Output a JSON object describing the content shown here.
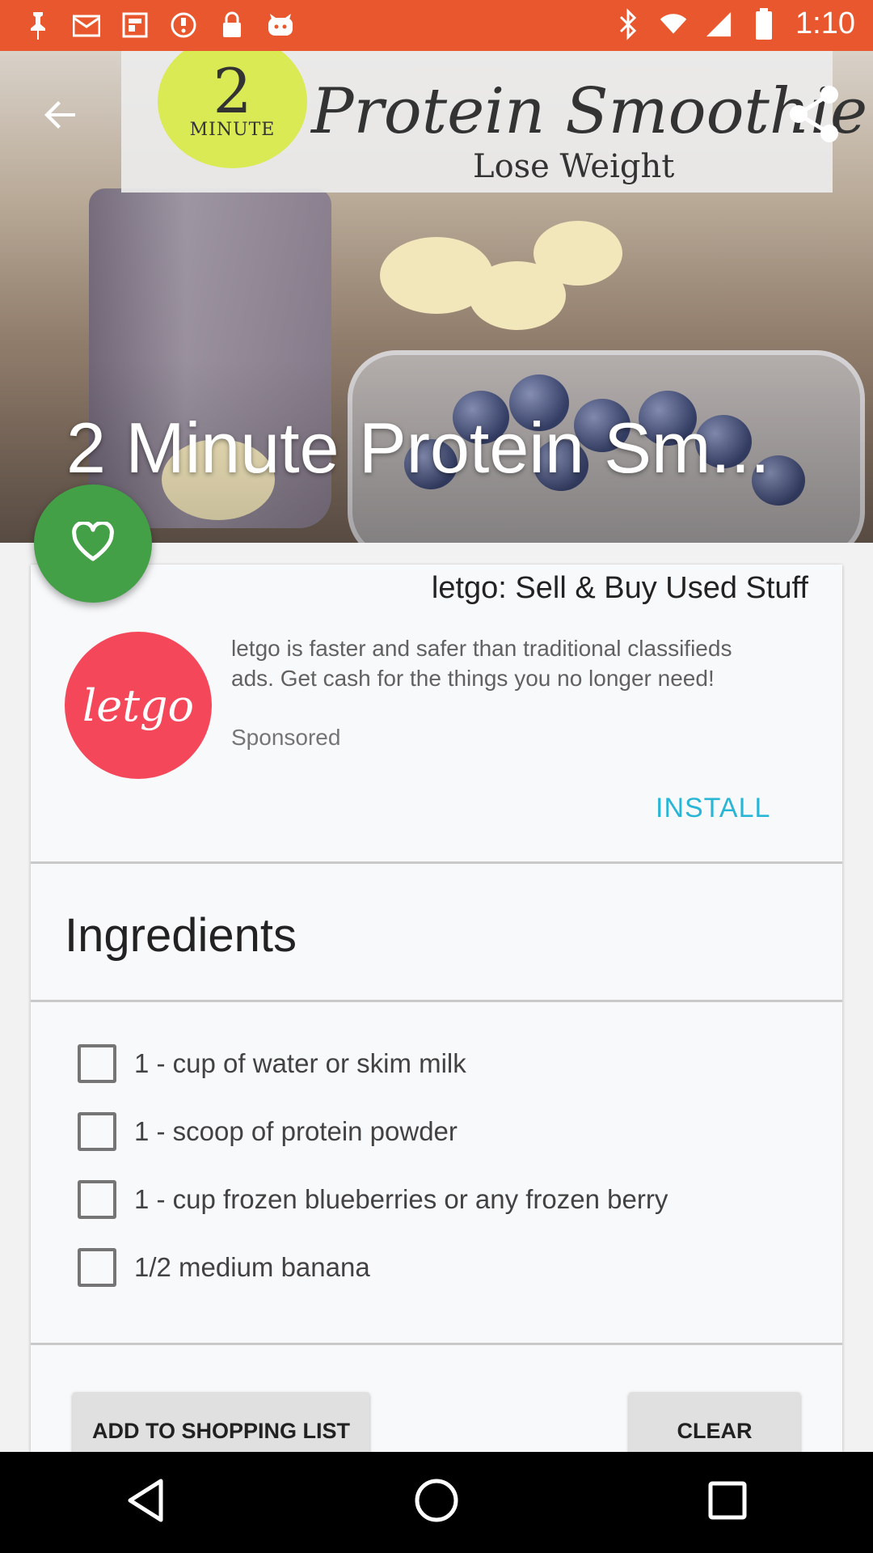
{
  "status_bar": {
    "time": "1:10",
    "icons": [
      "pin-icon",
      "mail-icon",
      "flipboard-icon",
      "download-icon",
      "lock-icon",
      "app-icon",
      "bluetooth-icon",
      "wifi-icon",
      "signal-icon",
      "battery-icon"
    ]
  },
  "hero": {
    "title": "2 Minute Protein Sm...",
    "image_text": {
      "sticker_number": "2",
      "sticker_label": "MINUTE",
      "script": "Protein Smoothie",
      "subtitle": "Lose Weight"
    }
  },
  "ad": {
    "title": "letgo: Sell & Buy Used Stuff",
    "logo_text": "letgo",
    "description": "letgo is faster and safer than traditional classifieds ads. Get cash for the things you no longer need!",
    "sponsored": "Sponsored",
    "install_label": "INSTALL"
  },
  "ingredients": {
    "heading": "Ingredients",
    "items": [
      {
        "text": "1 - cup of water or skim milk",
        "checked": false
      },
      {
        "text": "1 - scoop of protein powder",
        "checked": false
      },
      {
        "text": "1 - cup frozen blueberries or any frozen berry",
        "checked": false
      },
      {
        "text": "1/2 medium banana",
        "checked": false
      }
    ]
  },
  "actions": {
    "add_to_list_label": "ADD TO SHOPPING LIST",
    "clear_label": "CLEAR"
  },
  "colors": {
    "status_bar": "#e8572d",
    "fab": "#43a047",
    "install": "#29b6d6",
    "letgo_logo": "#f5475a"
  }
}
